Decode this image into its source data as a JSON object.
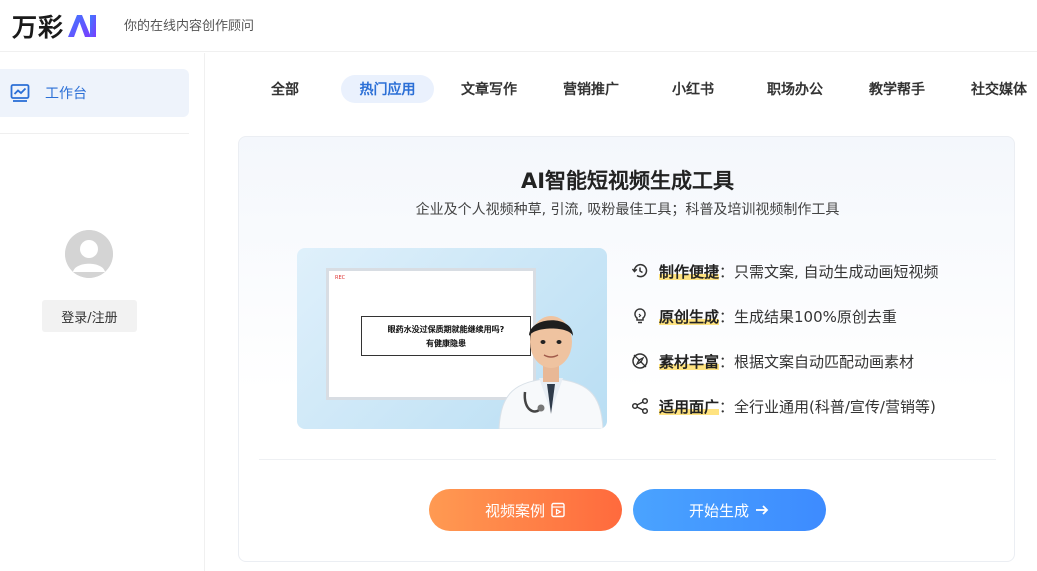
{
  "header": {
    "logo_text": "万彩",
    "tagline": "你的在线内容创作顾问"
  },
  "sidebar": {
    "nav_items": [
      {
        "label": "工作台",
        "icon": "chart-board-icon",
        "active": true
      }
    ],
    "login_label": "登录/注册"
  },
  "tabs": [
    {
      "label": "全部",
      "active": false
    },
    {
      "label": "热门应用",
      "active": true
    },
    {
      "label": "文章写作",
      "active": false
    },
    {
      "label": "营销推广",
      "active": false
    },
    {
      "label": "小红书",
      "active": false
    },
    {
      "label": "职场办公",
      "active": false
    },
    {
      "label": "教学帮手",
      "active": false
    },
    {
      "label": "社交媒体",
      "active": false
    }
  ],
  "card": {
    "title": "AI智能短视频生成工具",
    "subtitle": "企业及个人视频种草, 引流, 吸粉最佳工具；科普及培训视频制作工具",
    "preview": {
      "rec_label": "REC",
      "line1": "眼药水没过保质期就能继续用吗?",
      "line2": "有健康隐患"
    },
    "features": [
      {
        "key": "制作便捷",
        "value": "：只需文案, 自动生成动画短视频",
        "icon": "history-clock-icon"
      },
      {
        "key": "原创生成",
        "value": "：生成结果100%原创去重",
        "icon": "lightbulb-icon"
      },
      {
        "key": "素材丰富",
        "value": "：根据文案自动匹配动画素材",
        "icon": "compass-icon"
      },
      {
        "key": "适用面广",
        "value": "：全行业通用(科普/宣传/营销等)",
        "icon": "share-nodes-icon"
      }
    ],
    "buttons": {
      "case_label": "视频案例",
      "start_label": "开始生成"
    }
  },
  "colors": {
    "accent_blue": "#2b6fd6",
    "orange": "#ff6a3d",
    "highlight": "#ffd74a"
  }
}
